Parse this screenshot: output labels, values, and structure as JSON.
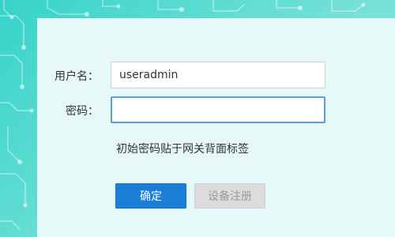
{
  "form": {
    "username_label": "用户名：",
    "username_value": "useradmin",
    "password_label": "密码：",
    "password_value": "",
    "hint": "初始密码贴于网关背面标签"
  },
  "buttons": {
    "confirm_label": "确定",
    "register_label": "设备注册"
  },
  "colors": {
    "background": "#4fd6cc",
    "panel": "#e6f8f8",
    "primary": "#1a7fd6",
    "disabled": "#dcdcdc"
  }
}
